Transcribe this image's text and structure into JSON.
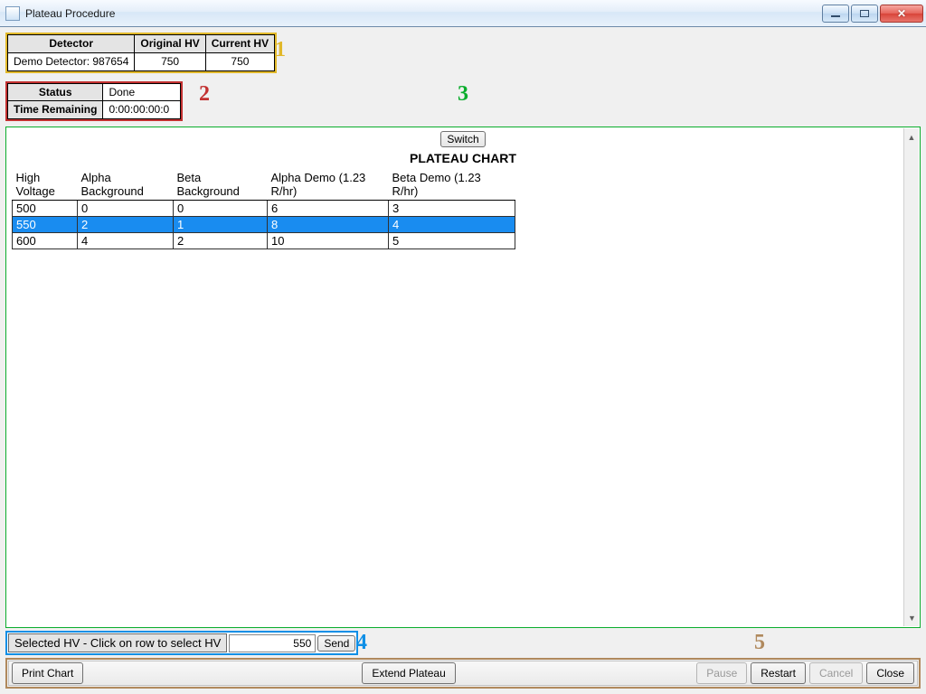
{
  "window": {
    "title": "Plateau Procedure"
  },
  "callouts": {
    "c1": "1",
    "c2": "2",
    "c3": "3",
    "c4": "4",
    "c5": "5"
  },
  "detector_table": {
    "headers": {
      "detector": "Detector",
      "original_hv": "Original HV",
      "current_hv": "Current HV"
    },
    "row": {
      "detector": "Demo Detector: 987654",
      "original_hv": "750",
      "current_hv": "750"
    }
  },
  "status_table": {
    "headers": {
      "status": "Status",
      "time_remaining": "Time Remaining"
    },
    "status_value": "Done",
    "time_value": "0:00:00:00:0"
  },
  "main": {
    "switch_label": "Switch",
    "chart_title": "PLATEAU CHART",
    "columns": {
      "hv": "High Voltage",
      "alpha_bg": "Alpha Background",
      "beta_bg": "Beta Background",
      "alpha_demo": "Alpha Demo (1.23 R/hr)",
      "beta_demo": "Beta Demo (1.23 R/hr)"
    },
    "rows": [
      {
        "hv": "500",
        "ab": "0",
        "bb": "0",
        "ad": "6",
        "bd": "3"
      },
      {
        "hv": "550",
        "ab": "2",
        "bb": "1",
        "ad": "8",
        "bd": "4"
      },
      {
        "hv": "600",
        "ab": "4",
        "bb": "2",
        "ad": "10",
        "bd": "5"
      }
    ],
    "selected_index": 1
  },
  "footer": {
    "selected_label": "Selected HV - Click on row to select HV",
    "selected_value": "550",
    "send_label": "Send"
  },
  "buttons": {
    "print_chart": "Print Chart",
    "extend_plateau": "Extend Plateau",
    "pause": "Pause",
    "restart": "Restart",
    "cancel": "Cancel",
    "close": "Close"
  },
  "chart_data": {
    "type": "table",
    "title": "PLATEAU CHART",
    "columns": [
      "High Voltage",
      "Alpha Background",
      "Beta Background",
      "Alpha Demo (1.23 R/hr)",
      "Beta Demo (1.23 R/hr)"
    ],
    "rows": [
      [
        500,
        0,
        0,
        6,
        3
      ],
      [
        550,
        2,
        1,
        8,
        4
      ],
      [
        600,
        4,
        2,
        10,
        5
      ]
    ]
  }
}
